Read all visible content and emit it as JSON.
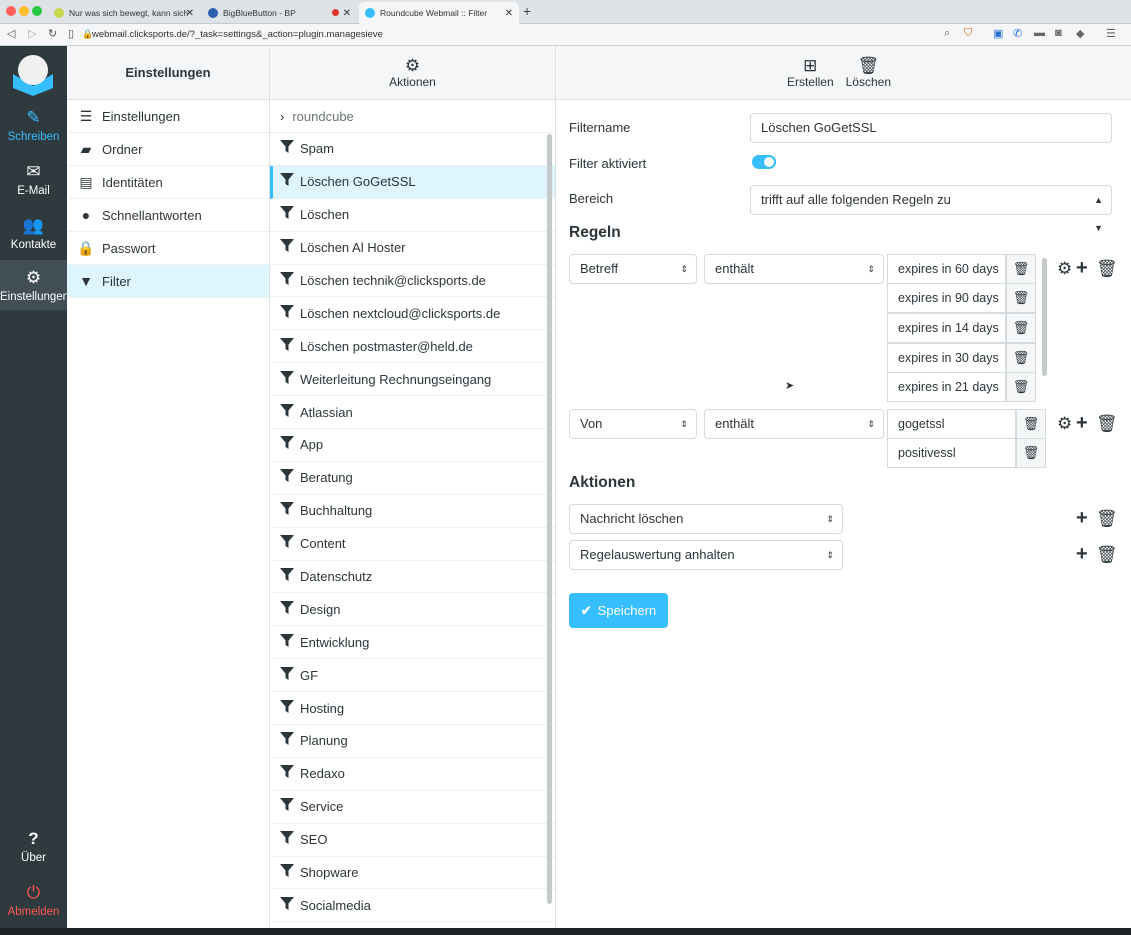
{
  "browser": {
    "tabs": [
      {
        "title": "Nur was sich bewegt, kann sich"
      },
      {
        "title": "BigBlueButton - BP"
      },
      {
        "title": "Roundcube Webmail :: Filter"
      }
    ],
    "url": "webmail.clicksports.de/?_task=settings&_action=plugin.managesieve"
  },
  "leftnav": {
    "compose": "Schreiben",
    "mail": "E-Mail",
    "contacts": "Kontakte",
    "settings": "Einstellungen",
    "about": "Über",
    "logout": "Abmelden"
  },
  "settings": {
    "title": "Einstellungen",
    "items": [
      "Einstellungen",
      "Ordner",
      "Identitäten",
      "Schnellantworten",
      "Passwort",
      "Filter"
    ]
  },
  "filters": {
    "actions_label": "Aktionen",
    "set_name": "roundcube",
    "items": [
      "Spam",
      "Löschen GoGetSSL",
      "Löschen",
      "Löschen Al Hoster",
      "Löschen technik@clicksports.de",
      "Löschen nextcloud@clicksports.de",
      "Löschen postmaster@held.de",
      "Weiterleitung Rechnungseingang",
      "Atlassian",
      "App",
      "Beratung",
      "Buchhaltung",
      "Content",
      "Datenschutz",
      "Design",
      "Entwicklung",
      "GF",
      "Hosting",
      "Planung",
      "Redaxo",
      "Service",
      "SEO",
      "Shopware",
      "Socialmedia"
    ]
  },
  "toolbar": {
    "create": "Erstellen",
    "delete": "Löschen"
  },
  "form": {
    "filtername_label": "Filtername",
    "filtername_value": "Löschen GoGetSSL",
    "enabled_label": "Filter aktiviert",
    "scope_label": "Bereich",
    "scope_value": "trifft auf alle folgenden Regeln zu",
    "rules_heading": "Regeln",
    "rule1_header": "Betreff",
    "rule1_op": "enthält",
    "rule1_values": [
      "expires in 60 days",
      "expires in 90 days",
      "expires in 14 days",
      "expires in 30 days",
      "expires in 21 days"
    ],
    "rule2_header": "Von",
    "rule2_op": "enthält",
    "rule2_values": [
      "gogetssl",
      "positivessl"
    ],
    "actions_heading": "Aktionen",
    "action1": "Nachricht löschen",
    "action2": "Regelauswertung anhalten",
    "save": "Speichern"
  }
}
